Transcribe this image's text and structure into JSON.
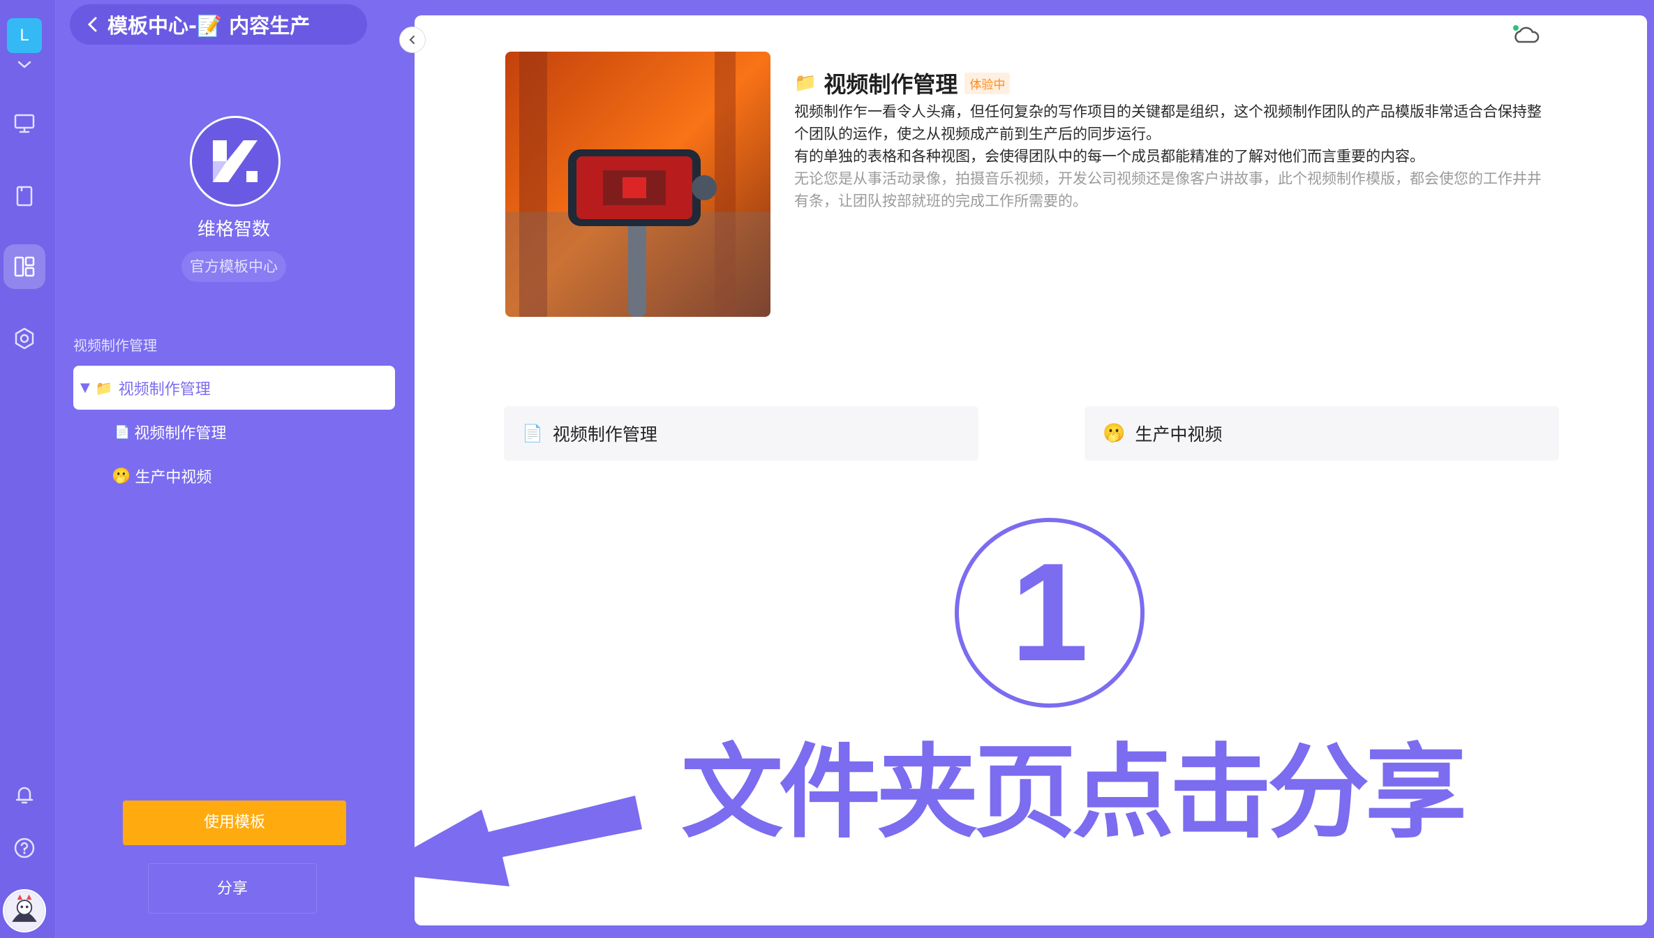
{
  "rail": {
    "avatar_letter": "L",
    "icons": [
      "monitor-icon",
      "document-icon",
      "template-icon",
      "settings-icon",
      "bell-icon",
      "help-icon"
    ]
  },
  "sidebar": {
    "header_title": "模板中心-📝 内容生产",
    "org_name": "维格智数",
    "org_badge": "官方模板中心",
    "section_label": "视频制作管理",
    "tree": [
      {
        "label": "视频制作管理",
        "icon": "📁",
        "selected": true
      },
      {
        "label": "视频制作管理",
        "icon": "📄"
      },
      {
        "label": "生产中视频",
        "icon": "🫢"
      }
    ],
    "use_template_label": "使用模板",
    "share_label": "分享"
  },
  "main": {
    "title_icon": "📁",
    "title": "视频制作管理",
    "trial_badge": "体验中",
    "desc_lines": [
      "视频制作乍一看令人头痛，但任何复杂的写作项目的关键都是组织，这个视频制作团队的产品模版非常适合合保持整个团队的运作，使之从视频成产前到生产后的同步运行。",
      "有的单独的表格和各种视图，会使得团队中的每一个成员都能精准的了解对他们而言重要的内容。",
      "无论您是从事活动录像，拍摄音乐视频，开发公司视频还是像客户讲故事，此个视频制作模版，都会使您的工作井井有条，让团队按部就班的完成工作所需要的。"
    ],
    "cards": [
      {
        "icon": "📄",
        "label": "视频制作管理"
      },
      {
        "icon": "🫢",
        "label": "生产中视频"
      }
    ]
  },
  "annotation": {
    "number": "1",
    "text": "文件夹页点击分享"
  },
  "colors": {
    "brand": "#7b6cf0",
    "accent_orange": "#ffab10",
    "badge_orange": "#ff8a1e"
  }
}
